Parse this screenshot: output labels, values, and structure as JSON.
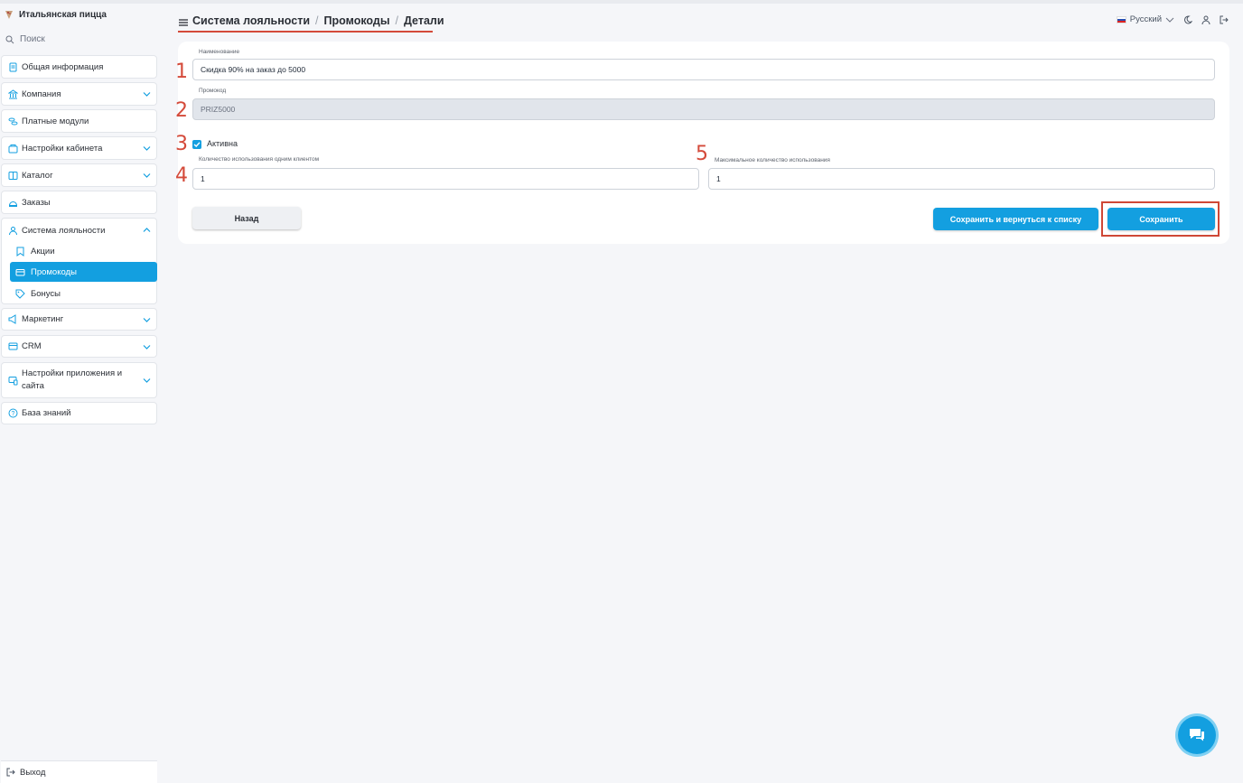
{
  "app": {
    "brand": "Итальянская пицца",
    "search_placeholder": "Поиск"
  },
  "sidebar": {
    "items": [
      {
        "label": "Общая информация"
      },
      {
        "label": "Компания"
      },
      {
        "label": "Платные модули"
      },
      {
        "label": "Настройки кабинета"
      },
      {
        "label": "Каталог"
      },
      {
        "label": "Заказы"
      },
      {
        "label": "Система лояльности"
      },
      {
        "label": "Маркетинг"
      },
      {
        "label": "CRM"
      },
      {
        "label": "Настройки приложения и сайта"
      },
      {
        "label": "База знаний"
      }
    ],
    "loyalty_sub": [
      {
        "label": "Акции"
      },
      {
        "label": "Промокоды"
      },
      {
        "label": "Бонусы"
      }
    ],
    "logout": "Выход"
  },
  "header": {
    "breadcrumb": [
      "Система лояльности",
      "Промокоды",
      "Детали"
    ],
    "separator": "/",
    "language": "Русский"
  },
  "form": {
    "name_label": "Наименование",
    "name_value": "Скидка 90% на заказ до 5000",
    "code_label": "Промокод",
    "code_value": "PRIZ5000",
    "active_label": "Активна",
    "active_checked": true,
    "per_client_label": "Количество использования одним клиентом",
    "per_client_value": "1",
    "max_label": "Максимальное количество использования",
    "max_value": "1"
  },
  "buttons": {
    "back": "Назад",
    "save_return": "Сохранить и вернуться к списку",
    "save": "Сохранить"
  },
  "annotations": [
    "1",
    "2",
    "3",
    "4",
    "5"
  ],
  "colors": {
    "accent": "#139fe0",
    "annotation": "#d44a3a",
    "background": "#f5f6f9"
  }
}
